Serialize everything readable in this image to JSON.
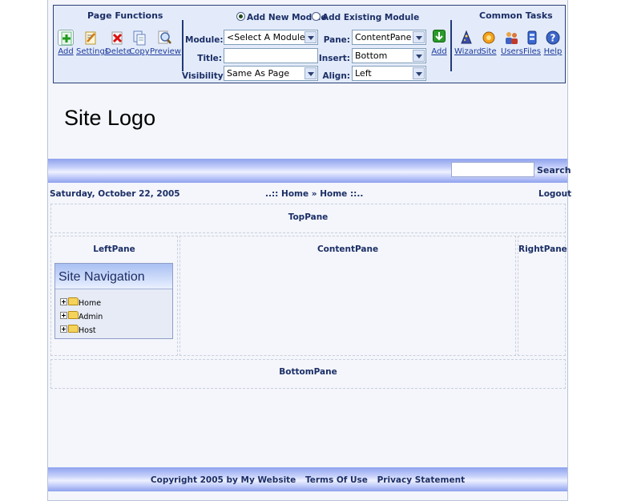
{
  "control_panel": {
    "page_functions": {
      "title": "Page Functions",
      "tools": [
        {
          "label": "Add",
          "icon": "add-page-icon"
        },
        {
          "label": "Settings",
          "icon": "settings-icon"
        },
        {
          "label": "Delete",
          "icon": "delete-icon"
        },
        {
          "label": "Copy",
          "icon": "copy-icon"
        },
        {
          "label": "Preview",
          "icon": "preview-icon"
        }
      ]
    },
    "module": {
      "add_new_label": "Add New Module",
      "add_existing_label": "Add Existing Module",
      "module_label": "Module:",
      "module_value": "<Select A Module>",
      "title_label": "Title:",
      "title_value": "",
      "visibility_label": "Visibility:",
      "visibility_value": "Same As Page",
      "pane_label": "Pane:",
      "pane_value": "ContentPane",
      "insert_label": "Insert:",
      "insert_value": "Bottom",
      "align_label": "Align:",
      "align_value": "Left",
      "add_label": "Add"
    },
    "common_tasks": {
      "title": "Common Tasks",
      "tools": [
        {
          "label": "Wizard",
          "icon": "wizard-icon"
        },
        {
          "label": "Site",
          "icon": "site-icon"
        },
        {
          "label": "Users",
          "icon": "users-icon"
        },
        {
          "label": "Files",
          "icon": "files-icon"
        },
        {
          "label": "Help",
          "icon": "help-icon"
        }
      ]
    }
  },
  "logo": "Site Logo",
  "search": {
    "button": "Search",
    "value": ""
  },
  "info_bar": {
    "date": "Saturday, October 22, 2005",
    "breadcrumb_prefix": "..::",
    "breadcrumb_1": "Home",
    "breadcrumb_sep": "»",
    "breadcrumb_2": "Home",
    "breadcrumb_suffix": "::..",
    "logout": "Logout"
  },
  "panes": {
    "top": "TopPane",
    "left": "LeftPane",
    "content": "ContentPane",
    "right": "RightPane",
    "bottom": "BottomPane"
  },
  "site_navigation": {
    "title": "Site Navigation",
    "items": [
      "Home",
      "Admin",
      "Host"
    ]
  },
  "footer": {
    "copyright": "Copyright 2005 by My Website",
    "terms": "Terms Of Use",
    "privacy": "Privacy Statement"
  },
  "colors": {
    "accent": "#1b2e66",
    "bar_blue": "#8ea2ee",
    "panel_bg": "#e3ebfa"
  }
}
